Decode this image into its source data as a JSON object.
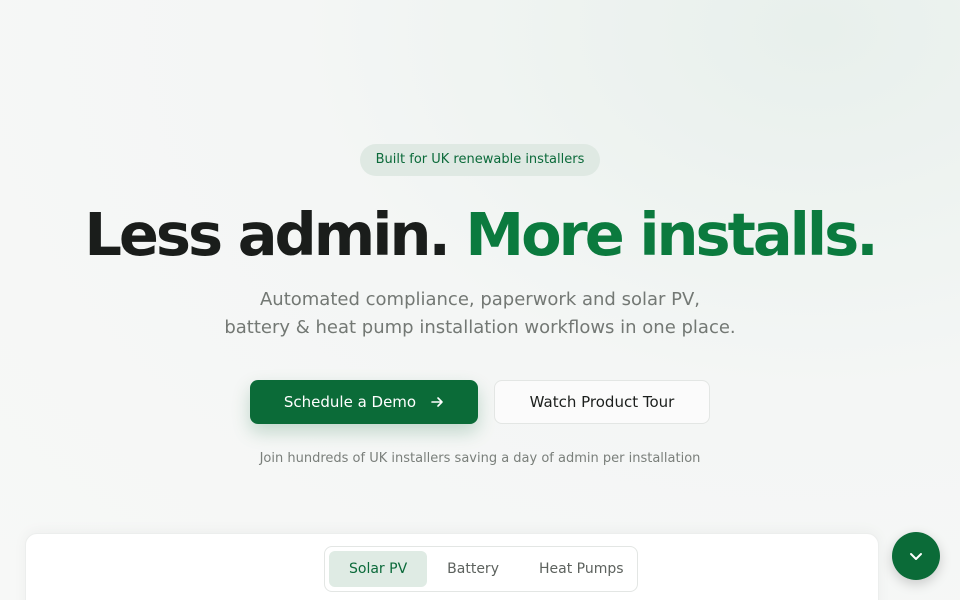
{
  "hero": {
    "badge": "Built for UK renewable installers",
    "headline_dark": "Less admin.",
    "headline_green": "More installs.",
    "subtitle_line1": "Automated compliance, paperwork and solar PV,",
    "subtitle_line2": "battery & heat pump installation workflows in one place.",
    "primary_cta": "Schedule a Demo",
    "secondary_cta": "Watch Product Tour",
    "social_proof": "Join hundreds of UK installers saving a day of admin per installation"
  },
  "product_tabs": {
    "items": [
      {
        "label": "Solar PV",
        "active": true
      },
      {
        "label": "Battery",
        "active": false
      },
      {
        "label": "Heat Pumps",
        "active": false
      }
    ]
  },
  "icons": {
    "cta_arrow": "arrow-right-icon",
    "chat": "chevron-down-icon"
  },
  "colors": {
    "brand_green": "#0b6b38",
    "headline_green": "#0b7a3e",
    "badge_bg": "#dfe9e3"
  }
}
